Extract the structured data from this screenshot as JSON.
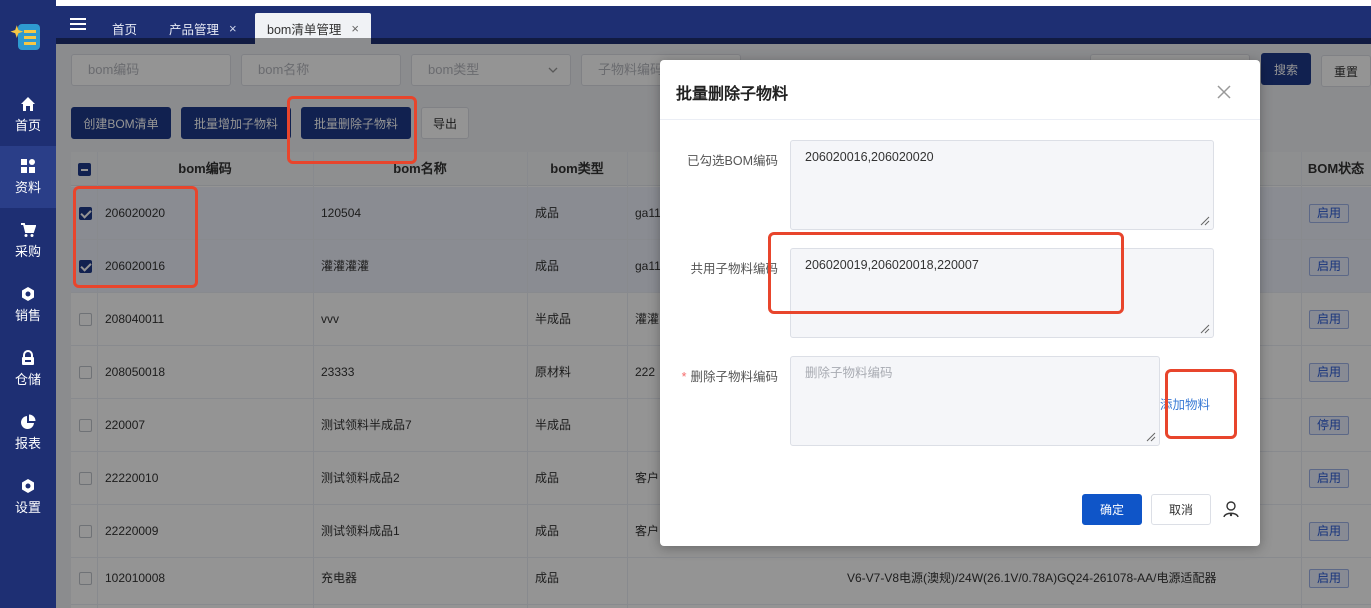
{
  "sidebar": {
    "items": [
      {
        "label": "首页",
        "icon": "home-icon"
      },
      {
        "label": "资料",
        "icon": "grid-icon"
      },
      {
        "label": "采购",
        "icon": "cart-icon"
      },
      {
        "label": "销售",
        "icon": "hexagon-icon"
      },
      {
        "label": "仓储",
        "icon": "lock-icon"
      },
      {
        "label": "报表",
        "icon": "pie-icon"
      },
      {
        "label": "设置",
        "icon": "gear-icon"
      }
    ]
  },
  "tabs": [
    {
      "label": "首页"
    },
    {
      "label": "产品管理",
      "close": "×"
    },
    {
      "label": "bom清单管理",
      "close": "×"
    }
  ],
  "filters": {
    "bom_code": "bom编码",
    "bom_name": "bom名称",
    "bom_type": "bom类型",
    "child_code": "子物料编码"
  },
  "buttons": {
    "search": "搜索",
    "reset": "重置",
    "create": "创建BOM清单",
    "batch_add": "批量增加子物料",
    "batch_delete": "批量删除子物料",
    "export": "导出"
  },
  "table": {
    "headers": {
      "code": "bom编码",
      "name": "bom名称",
      "type": "bom类型",
      "status": "BOM状态"
    },
    "rows": [
      {
        "code": "206020020",
        "name": "120504",
        "type": "成品",
        "desc": "ga11",
        "status": "启用",
        "checked": true
      },
      {
        "code": "206020016",
        "name": "灌灌灌灌",
        "type": "成品",
        "desc": "ga11",
        "status": "启用",
        "checked": true
      },
      {
        "code": "208040011",
        "name": "vvv",
        "type": "半成品",
        "desc": "灌灌",
        "status": "启用",
        "checked": false
      },
      {
        "code": "208050018",
        "name": "23333",
        "type": "原材料",
        "desc": "222",
        "status": "启用",
        "checked": false
      },
      {
        "code": "220007",
        "name": "测试领料半成品7",
        "type": "半成品",
        "desc": "",
        "status": "停用",
        "checked": false
      },
      {
        "code": "22220010",
        "name": "测试领料成品2",
        "type": "成品",
        "desc": "客户",
        "status": "启用",
        "checked": false
      },
      {
        "code": "22220009",
        "name": "测试领料成品1",
        "type": "成品",
        "desc": "客户",
        "status": "启用",
        "checked": false
      },
      {
        "code": "102010008",
        "name": "充电器",
        "type": "成品",
        "desc": "V6-V7-V8电源(澳规)/24W(26.1V/0.78A)GQ24-261078-AA/电源适配器",
        "status": "启用",
        "checked": false
      }
    ]
  },
  "modal": {
    "title": "批量删除子物料",
    "selected_label": "已勾选BOM编码",
    "selected_value": "206020016,206020020",
    "shared_label": "共用子物料编码",
    "shared_value": "206020019,206020018,220007",
    "delete_label": "删除子物料编码",
    "required_mark": "*",
    "delete_placeholder": "删除子物料编码",
    "add_link": "添加物料",
    "confirm": "确定",
    "cancel": "取消"
  },
  "colors": {
    "primary": "#1e3a8a",
    "sidebar": "#1e2f73",
    "highlight": "#e8452c"
  }
}
